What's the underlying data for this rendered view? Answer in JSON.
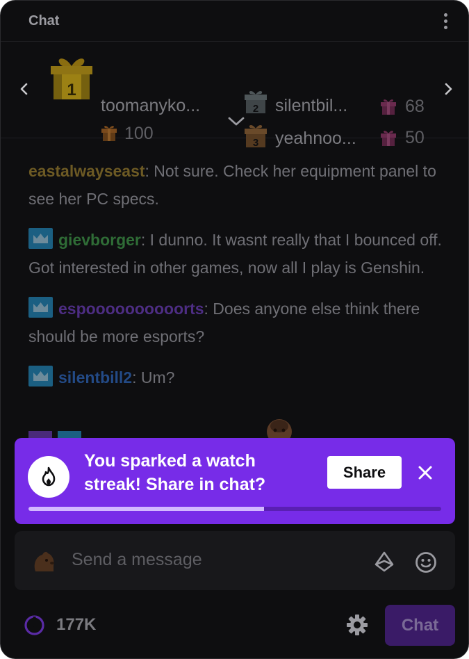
{
  "header": {
    "title": "Chat"
  },
  "leaderboard": {
    "first": {
      "rank": "1",
      "name": "toomanyko...",
      "count": "100"
    },
    "second": {
      "rank": "2",
      "name": "silentbil...",
      "count": "68"
    },
    "third": {
      "rank": "3",
      "name": "yeahnoo...",
      "count": "50"
    }
  },
  "messages": [
    {
      "user": "eastalwayseast",
      "text": ": Not sure. Check her equipment panel to see her PC specs."
    },
    {
      "user": "gievborger",
      "text": ": I dunno. It wasnt really that I bounced off. Got interested in other games, now all I play is Genshin."
    },
    {
      "user": "espoooooooooorts",
      "text": ": Does anyone else think there should be more esports?"
    },
    {
      "user": "silentbill2",
      "text": ": Um?"
    }
  ],
  "streak": {
    "text": "You sparked a watch streak! Share in chat?",
    "share_label": "Share",
    "progress": 0.57
  },
  "input": {
    "placeholder": "Send a message"
  },
  "footer": {
    "viewers": "177K",
    "chat_label": "Chat"
  },
  "colors": {
    "accent": "#772ce8",
    "background": "#0e0e10",
    "user_gold": "#6d5a24",
    "user_green": "#2f6c36",
    "user_purple": "#4d2d83",
    "user_blue": "#234a86"
  },
  "icons": {
    "kebab": "more-vertical-icon",
    "nav_left": "chevron-left-icon",
    "nav_right": "chevron-right-icon",
    "expand": "chevron-down-icon",
    "gift": "gift-icon",
    "badge": "crown-badge-icon",
    "streak": "flame-icon",
    "close": "close-icon",
    "bits": "bits-icon",
    "emoji": "smiley-icon",
    "viewers": "clock-icon",
    "settings": "gear-icon"
  }
}
